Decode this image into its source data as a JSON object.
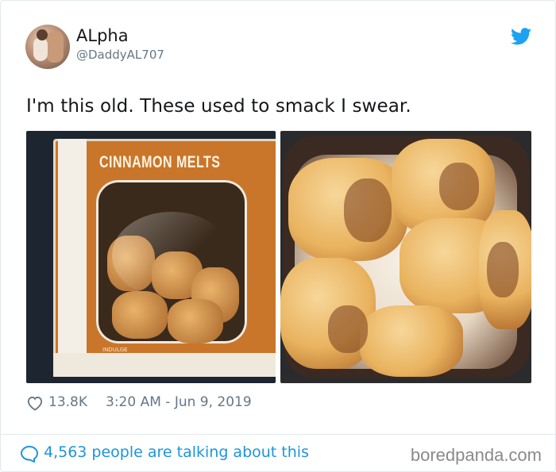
{
  "tweet": {
    "author_name": "ALpha",
    "author_handle": "@DaddyAL707",
    "text": "I'm this old. These used to smack I swear.",
    "likes": "13.8K",
    "timestamp": "3:20 AM - Jun 9, 2019"
  },
  "media": {
    "left_photo": {
      "box_label": "CINNAMON MELTS",
      "box_small_text": "INDULGE"
    },
    "right_photo": {}
  },
  "footer": {
    "conversation_text": "4,563 people are talking about this"
  },
  "watermark": "boredpanda.com",
  "icons": {
    "brand": "twitter-bird-icon",
    "like": "heart-icon",
    "reply": "speech-bubble-icon"
  },
  "colors": {
    "twitter_blue": "#1da1f2",
    "link_blue": "#1b95e0",
    "meta_gray": "#657786"
  }
}
